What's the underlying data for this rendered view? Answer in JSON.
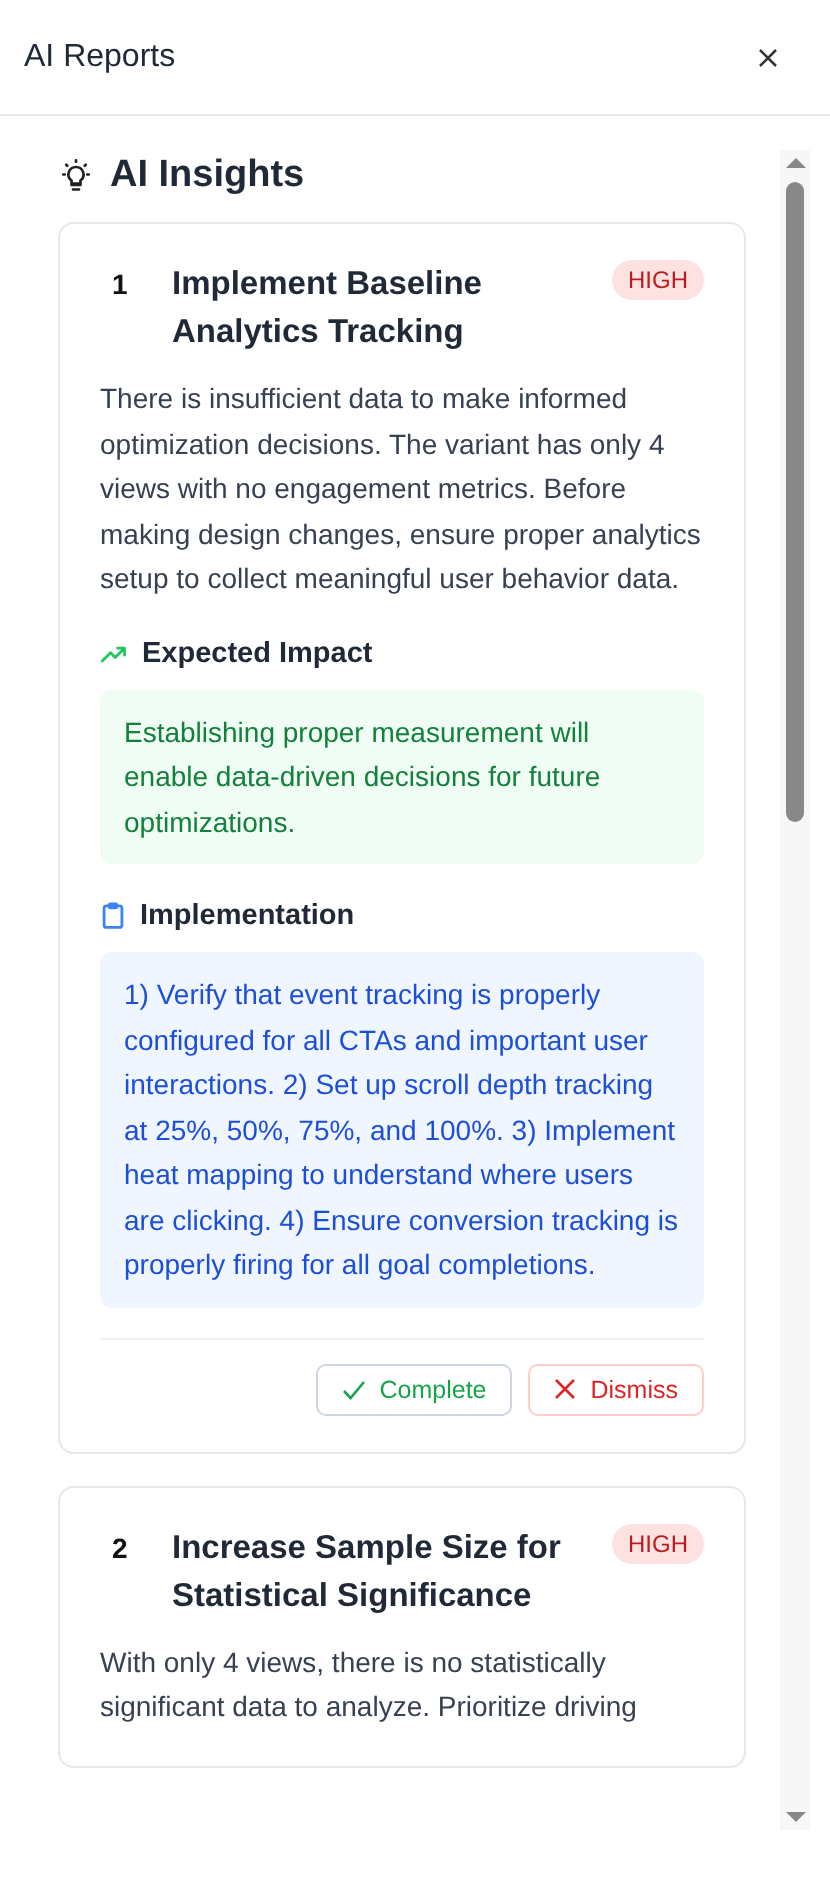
{
  "header": {
    "title": "AI Reports"
  },
  "section": {
    "title": "AI Insights"
  },
  "insights": [
    {
      "number": "1",
      "title": "Implement Baseline Analytics Tracking",
      "priority": {
        "label": "HIGH",
        "kind": "high"
      },
      "description": "There is insufficient data to make informed optimization decisions. The variant has only 4 views with no engagement metrics. Before making design changes, ensure proper analytics setup to collect meaningful user behavior data.",
      "impact_label": "Expected Impact",
      "impact": "Establishing proper measurement will enable data-driven decisions for future optimizations.",
      "implementation_label": "Implementation",
      "implementation": "1) Verify that event tracking is properly configured for all CTAs and important user interactions. 2) Set up scroll depth tracking at 25%, 50%, 75%, and 100%. 3) Implement heat mapping to understand where users are clicking. 4) Ensure conversion tracking is properly firing for all goal completions.",
      "actions": [
        {
          "label": "Complete",
          "kind": "complete"
        },
        {
          "label": "Dismiss",
          "kind": "dismiss"
        }
      ]
    },
    {
      "number": "2",
      "title": "Increase Sample Size for Statistical Significance",
      "priority": {
        "label": "HIGH",
        "kind": "high"
      },
      "description": "With only 4 views, there is no statistically significant data to analyze. Prioritize driving"
    }
  ]
}
